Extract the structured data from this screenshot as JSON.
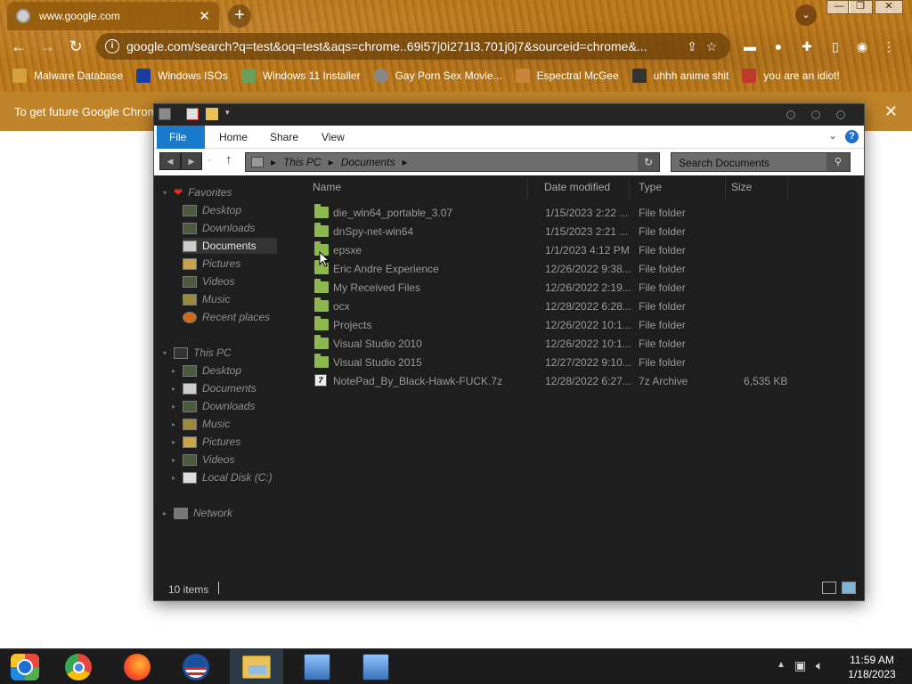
{
  "browser": {
    "tab": {
      "title": "www.google.com"
    },
    "url": "google.com/search?q=test&oq=test&aqs=chrome..69i57j0i271l3.701j0j7&sourceid=chrome&...",
    "bookmarks": [
      {
        "label": "Malware Database",
        "icon": "folder-icon",
        "color": "#d4a23a"
      },
      {
        "label": "Windows ISOs",
        "icon": "x-logo-icon",
        "color": "#1a3e9e"
      },
      {
        "label": "Windows 11 Installer",
        "icon": "image-icon",
        "color": "#6aa05a"
      },
      {
        "label": "Gay Porn Sex Movie...",
        "icon": "disc-icon",
        "color": "#888888"
      },
      {
        "label": "Espectral McGee",
        "icon": "avatar-icon",
        "color": "#c9853a"
      },
      {
        "label": "uhhh anime shit",
        "icon": "anime-icon",
        "color": "#333333"
      },
      {
        "label": "you are an idiot!",
        "icon": "flag-icon",
        "color": "#c0392b"
      }
    ],
    "infobar_text": "To get future Google Chrom"
  },
  "explorer": {
    "ribbon_tabs": [
      "File",
      "Home",
      "Share",
      "View"
    ],
    "breadcrumb": [
      "This PC",
      "Documents"
    ],
    "search_placeholder": "Search Documents",
    "columns": [
      "Name",
      "Date modified",
      "Type",
      "Size"
    ],
    "nav": {
      "favorites_label": "Favorites",
      "favorites": [
        "Desktop",
        "Downloads",
        "Documents",
        "Pictures",
        "Videos",
        "Music",
        "Recent places"
      ],
      "thispc_label": "This PC",
      "thispc": [
        "Desktop",
        "Documents",
        "Downloads",
        "Music",
        "Pictures",
        "Videos",
        "Local Disk (C:)"
      ],
      "network_label": "Network"
    },
    "files": [
      {
        "name": "die_win64_portable_3.07",
        "date": "1/15/2023 2:22 ...",
        "type": "File folder",
        "size": "",
        "kind": "folder"
      },
      {
        "name": "dnSpy-net-win64",
        "date": "1/15/2023 2:21 ...",
        "type": "File folder",
        "size": "",
        "kind": "folder"
      },
      {
        "name": "epsxe",
        "date": "1/1/2023 4:12 PM",
        "type": "File folder",
        "size": "",
        "kind": "folder"
      },
      {
        "name": "Eric Andre Experience",
        "date": "12/26/2022 9:38...",
        "type": "File folder",
        "size": "",
        "kind": "folder"
      },
      {
        "name": "My Received Files",
        "date": "12/26/2022 2:19...",
        "type": "File folder",
        "size": "",
        "kind": "folder"
      },
      {
        "name": "ocx",
        "date": "12/28/2022 6:28...",
        "type": "File folder",
        "size": "",
        "kind": "folder"
      },
      {
        "name": "Projects",
        "date": "12/26/2022 10:1...",
        "type": "File folder",
        "size": "",
        "kind": "folder"
      },
      {
        "name": "Visual Studio 2010",
        "date": "12/26/2022 10:1...",
        "type": "File folder",
        "size": "",
        "kind": "folder"
      },
      {
        "name": "Visual Studio 2015",
        "date": "12/27/2022 9:10...",
        "type": "File folder",
        "size": "",
        "kind": "folder"
      },
      {
        "name": "NotePad_By_Black-Hawk-FUCK.7z",
        "date": "12/28/2022 6:27...",
        "type": "7z Archive",
        "size": "6,535 KB",
        "kind": "archive"
      }
    ],
    "status": "10 items"
  },
  "taskbar": {
    "apps": [
      {
        "name": "start-button",
        "color": "#1e6fd8"
      },
      {
        "name": "chrome-icon",
        "color": "#e8453c"
      },
      {
        "name": "firefox-icon",
        "color": "#ff7a1a"
      },
      {
        "name": "obama-logo-icon",
        "color": "#1b4f9c"
      },
      {
        "name": "file-explorer-icon",
        "color": "#e8c15a"
      },
      {
        "name": "network-setup-icon",
        "color": "#5a8fd0"
      },
      {
        "name": "network-setup-icon-2",
        "color": "#5a8fd0"
      }
    ],
    "time": "11:59 AM",
    "date": "1/18/2023"
  }
}
